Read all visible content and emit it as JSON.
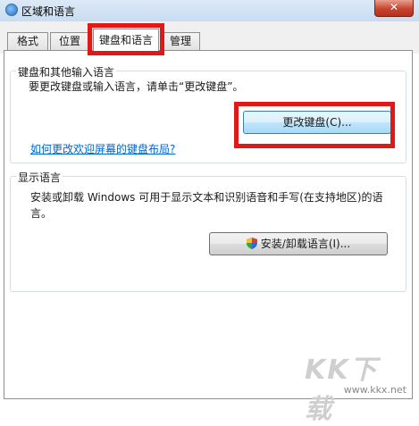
{
  "window": {
    "title": "区域和语言",
    "close_label": "✕"
  },
  "tabs": [
    {
      "label": "格式"
    },
    {
      "label": "位置"
    },
    {
      "label": "键盘和语言"
    },
    {
      "label": "管理"
    }
  ],
  "keyboard_group": {
    "title": "键盘和其他输入语言",
    "description": "要更改键盘或输入语言，请单击“更改键盘”。",
    "change_button": "更改键盘(C)...",
    "help_link": "如何更改欢迎屏幕的键盘布局?"
  },
  "display_group": {
    "title": "显示语言",
    "description_line1": "安装或卸载 Windows 可用于显示文本和识别语音和手写(在支持地区)的语",
    "description_line2": "言。",
    "install_button": "安装/卸载语言(I)..."
  },
  "icons": {
    "title": "region-globe-icon",
    "shield": "uac-shield-icon"
  },
  "colors": {
    "highlight": "#e01818",
    "link": "#0066cc"
  },
  "watermark": {
    "logo": "KK下载",
    "url": "www.kkx.net"
  }
}
